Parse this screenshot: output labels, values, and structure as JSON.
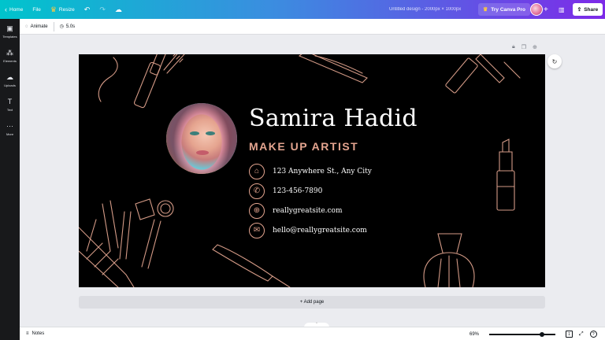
{
  "topbar": {
    "back_icon": "chevron-left-icon",
    "home": "Home",
    "file": "File",
    "resize": "Resize",
    "resize_icon": "crown-icon",
    "undo_icon": "undo-icon",
    "redo_icon": "redo-icon",
    "cloud_icon": "cloud-saved-icon",
    "doc_title": "Untitled design - 2000px × 1000px",
    "try_pro": "Try Canva Pro",
    "share": "Share",
    "colors": {
      "gradient_start": "#00c4cc",
      "gradient_end": "#7d2ae8"
    }
  },
  "sidebar": {
    "items": [
      {
        "label": "Templates",
        "icon": "templates-icon"
      },
      {
        "label": "Elements",
        "icon": "elements-icon"
      },
      {
        "label": "Uploads",
        "icon": "upload-cloud-icon"
      },
      {
        "label": "Text",
        "icon": "text-t-icon"
      },
      {
        "label": "More",
        "icon": "more-dots-icon"
      }
    ]
  },
  "toolbar2": {
    "animate": "Animate",
    "duration": "5.0s"
  },
  "card": {
    "name": "Samira Hadid",
    "role": "MAKE UP ARTIST",
    "contacts": [
      {
        "icon": "home-icon",
        "text": "123 Anywhere St., Any City"
      },
      {
        "icon": "phone-icon",
        "text": "123-456-7890"
      },
      {
        "icon": "globe-icon",
        "text": "reallygreatsite.com"
      },
      {
        "icon": "mail-icon",
        "text": "hello@reallygreatsite.com"
      }
    ],
    "colors": {
      "background": "#000000",
      "accent": "#e3a48f",
      "text": "#ffffff"
    }
  },
  "canvas": {
    "add_page": "+ Add page"
  },
  "bottombar": {
    "notes": "Notes",
    "zoom": "69%",
    "zoom_fraction": 0.8,
    "page_count": "1"
  }
}
